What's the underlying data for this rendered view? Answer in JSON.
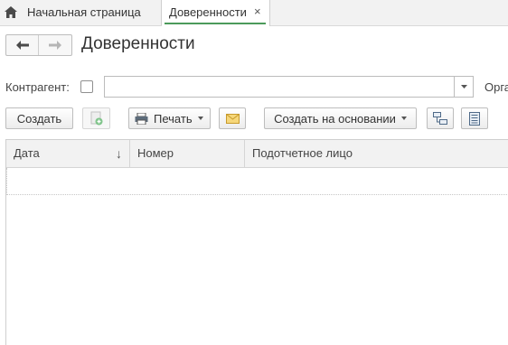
{
  "tabs": {
    "home_label": "Начальная страница",
    "active_label": "Доверенности",
    "close_symbol": "×"
  },
  "header": {
    "title": "Доверенности"
  },
  "filter": {
    "counterparty_label": "Контрагент:",
    "counterparty_value": "",
    "organization_label_partial": "Орга"
  },
  "toolbar": {
    "create_label": "Создать",
    "print_label": "Печать",
    "create_basis_label": "Создать на основании"
  },
  "table": {
    "columns": [
      "Дата",
      "Номер",
      "Подотчетное лицо"
    ],
    "sort_indicator": "↓",
    "rows": []
  },
  "colors": {
    "active_tab_underline": "#4c9a5b",
    "header_bg": "#f2f2f2",
    "border": "#bdbdbd"
  },
  "icons": [
    "home-icon",
    "back-arrow-icon",
    "forward-arrow-icon",
    "dropdown-arrow-icon",
    "copy-add-icon",
    "printer-icon",
    "envelope-icon",
    "structure-icon",
    "list-settings-icon"
  ]
}
